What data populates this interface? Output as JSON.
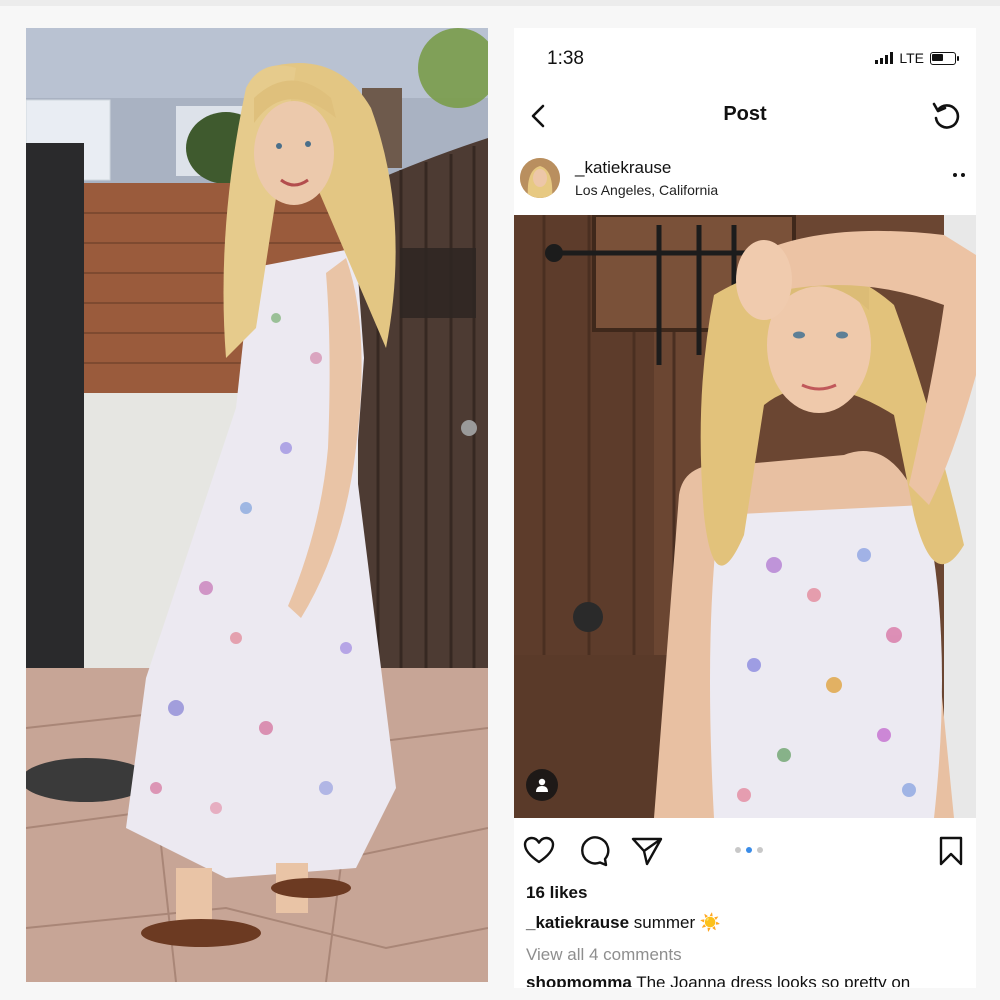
{
  "status_bar": {
    "time": "1:38",
    "network": "LTE",
    "battery_level": 0.55
  },
  "nav": {
    "title": "Post"
  },
  "post": {
    "username": "_katiekrause",
    "location": "Los Angeles, California",
    "carousel": {
      "count": 3,
      "active_index": 1
    },
    "likes": "16 likes",
    "caption_user": "_katiekrause",
    "caption_text": "summer",
    "caption_emoji": "☀️",
    "view_comments": "View all 4 comments",
    "comment_user": "shopmomma",
    "comment_text": "The Joanna dress looks so pretty on"
  },
  "icons": {
    "back": "chevron-left-icon",
    "refresh": "refresh-icon",
    "more": "more-icon",
    "like": "heart-icon",
    "comment": "comment-icon",
    "share": "send-icon",
    "save": "bookmark-icon",
    "tag": "user-tag-icon"
  }
}
